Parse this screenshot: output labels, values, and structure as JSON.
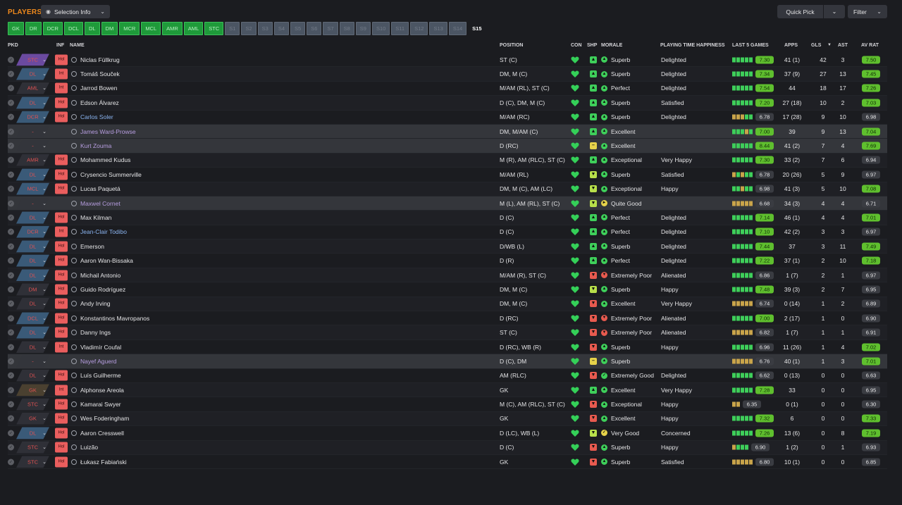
{
  "title": "PLAYERS",
  "selection_info": "Selection Info",
  "quick_pick": "Quick Pick",
  "filter": "Filter",
  "tabs": [
    "GK",
    "DR",
    "DCR",
    "DCL",
    "DL",
    "DM",
    "MCR",
    "MCL",
    "AMR",
    "AML",
    "STC",
    "S1",
    "S2",
    "S3",
    "S4",
    "S5",
    "S6",
    "S7",
    "S8",
    "S9",
    "S10",
    "S11",
    "S12",
    "S13",
    "S14",
    "S15"
  ],
  "headers": {
    "pkd": "PKD",
    "inf": "INF",
    "name": "NAME",
    "position": "POSITION",
    "con": "CON",
    "shp": "SHP",
    "morale": "MORALE",
    "pth": "PLAYING TIME HAPPINESS",
    "last5": "LAST 5 GAMES",
    "apps": "APPS",
    "gls": "GLS",
    "ast": "AST",
    "avrat": "AV RAT"
  },
  "colors": {
    "accent": "#f08a1c",
    "green_rating": "#5fbf2e",
    "grey_rating": "#3a3c42"
  },
  "players": [
    {
      "pkd": "STC",
      "pkdc": "#6b4aa0",
      "inf": "Hol",
      "name": "Niclas Füllkrug",
      "position": "ST (C)",
      "shp": "up",
      "morale": "Superb",
      "pth": "Delighted",
      "l5": "7.30",
      "l5g": true,
      "bars": "GGGGG",
      "apps": "41 (1)",
      "gls": "42",
      "ast": "3",
      "av": "7.50",
      "avg": true
    },
    {
      "pkd": "DL",
      "pkdc": "#3a5a78",
      "inf": "Int",
      "name": "Tomáš Souček",
      "position": "DM, M (C)",
      "shp": "up",
      "morale": "Superb",
      "pth": "Delighted",
      "l5": "7.34",
      "l5g": true,
      "bars": "GGGGG",
      "apps": "37 (9)",
      "gls": "27",
      "ast": "13",
      "av": "7.45",
      "avg": true
    },
    {
      "pkd": "AML",
      "pkdc": "#2f3037",
      "inf": "Int",
      "name": "Jarrod Bowen",
      "position": "M/AM (RL), ST (C)",
      "shp": "up",
      "morale": "Perfect",
      "pth": "Delighted",
      "l5": "7.54",
      "l5g": true,
      "bars": "GGGGG",
      "apps": "44",
      "gls": "18",
      "ast": "17",
      "av": "7.26",
      "avg": true
    },
    {
      "pkd": "DL",
      "pkdc": "#3a5a78",
      "inf": "Hol",
      "name": "Edson Álvarez",
      "position": "D (C), DM, M (C)",
      "shp": "up",
      "morale": "Superb",
      "pth": "Satisfied",
      "l5": "7.20",
      "l5g": true,
      "bars": "GGGGG",
      "apps": "27 (18)",
      "gls": "10",
      "ast": "2",
      "av": "7.03",
      "avg": true
    },
    {
      "pkd": "DCR",
      "pkdc": "#3a5a78",
      "inf": "Hol",
      "name": "Carlos Soler",
      "nc": "hl",
      "position": "M/AM (RC)",
      "shp": "up",
      "morale": "Superb",
      "pth": "Delighted",
      "l5": "6.78",
      "l5g": false,
      "bars": "YYYGG",
      "apps": "17 (28)",
      "gls": "9",
      "ast": "10",
      "av": "6.98",
      "avg": false
    },
    {
      "pkd": "-",
      "pkdc": "#33353b",
      "inf": "",
      "name": "James Ward-Prowse",
      "nc": "purple",
      "position": "DM, M/AM (C)",
      "shp": "up",
      "morale": "Excellent",
      "pth": "",
      "l5": "7.00",
      "l5g": true,
      "bars": "GGGYG",
      "apps": "39",
      "gls": "9",
      "ast": "13",
      "av": "7.04",
      "avg": true,
      "dark": true
    },
    {
      "pkd": "-",
      "pkdc": "#33353b",
      "inf": "",
      "name": "Kurt Zouma",
      "nc": "purple",
      "position": "D (RC)",
      "shp": "flat",
      "morale": "Excellent",
      "pth": "",
      "l5": "8.44",
      "l5g": true,
      "bars": "GGGGG",
      "apps": "41 (2)",
      "gls": "7",
      "ast": "4",
      "av": "7.69",
      "avg": true,
      "dark": true
    },
    {
      "pkd": "AMR",
      "pkdc": "#2f3037",
      "inf": "Hol",
      "name": "Mohammed Kudus",
      "position": "M (R), AM (RLC), ST (C)",
      "shp": "up",
      "morale": "Exceptional",
      "pth": "Very Happy",
      "l5": "7.30",
      "l5g": true,
      "bars": "GGGGG",
      "apps": "33 (2)",
      "gls": "7",
      "ast": "6",
      "av": "6.94",
      "avg": false
    },
    {
      "pkd": "DL",
      "pkdc": "#3a5a78",
      "inf": "Hol",
      "name": "Crysencio Summerville",
      "position": "M/AM (RL)",
      "shp": "down",
      "morale": "Superb",
      "pth": "Satisfied",
      "l5": "6.78",
      "l5g": false,
      "bars": "YGYGG",
      "apps": "20 (26)",
      "gls": "5",
      "ast": "9",
      "av": "6.97",
      "avg": false
    },
    {
      "pkd": "MCL",
      "pkdc": "#3a5a78",
      "inf": "Hol",
      "name": "Lucas Paquetá",
      "position": "DM, M (C), AM (LC)",
      "shp": "down",
      "morale": "Exceptional",
      "pth": "Happy",
      "l5": "6.98",
      "l5g": false,
      "bars": "GGYGG",
      "apps": "41 (3)",
      "gls": "5",
      "ast": "10",
      "av": "7.08",
      "avg": true
    },
    {
      "pkd": "-",
      "pkdc": "#33353b",
      "inf": "",
      "name": "Maxwel Cornet",
      "nc": "purple",
      "position": "M (L), AM (RL), ST (C)",
      "shp": "down",
      "morale": "Quite Good",
      "pth": "",
      "l5": "6.68",
      "l5g": false,
      "bars": "YYYYY",
      "apps": "34 (3)",
      "gls": "4",
      "ast": "4",
      "av": "6.71",
      "avg": false,
      "dark": true
    },
    {
      "pkd": "DL",
      "pkdc": "#3a5a78",
      "inf": "Hol",
      "name": "Max Kilman",
      "position": "D (C)",
      "shp": "up",
      "morale": "Perfect",
      "pth": "Delighted",
      "l5": "7.14",
      "l5g": true,
      "bars": "GGGGG",
      "apps": "46 (1)",
      "gls": "4",
      "ast": "4",
      "av": "7.01",
      "avg": true
    },
    {
      "pkd": "DCR",
      "pkdc": "#3a5a78",
      "inf": "Int",
      "name": "Jean-Clair Todibo",
      "nc": "hl",
      "position": "D (C)",
      "shp": "up",
      "morale": "Perfect",
      "pth": "Delighted",
      "l5": "7.10",
      "l5g": true,
      "bars": "GGGGG",
      "apps": "42 (2)",
      "gls": "3",
      "ast": "3",
      "av": "6.97",
      "avg": false
    },
    {
      "pkd": "DL",
      "pkdc": "#3a5a78",
      "inf": "Hol",
      "name": "Emerson",
      "position": "D/WB (L)",
      "shp": "up",
      "morale": "Superb",
      "pth": "Delighted",
      "l5": "7.44",
      "l5g": true,
      "bars": "GGGGG",
      "apps": "37",
      "gls": "3",
      "ast": "11",
      "av": "7.49",
      "avg": true
    },
    {
      "pkd": "DL",
      "pkdc": "#3a5a78",
      "inf": "Hol",
      "name": "Aaron Wan-Bissaka",
      "position": "D (R)",
      "shp": "up",
      "morale": "Perfect",
      "pth": "Delighted",
      "l5": "7.22",
      "l5g": true,
      "bars": "GGGGG",
      "apps": "37 (1)",
      "gls": "2",
      "ast": "10",
      "av": "7.18",
      "avg": true
    },
    {
      "pkd": "DL",
      "pkdc": "#3a5a78",
      "inf": "Hol",
      "name": "Michail Antonio",
      "position": "M/AM (R), ST (C)",
      "shp": "bad",
      "morale": "Extremely Poor",
      "pth": "Alienated",
      "l5": "6.86",
      "l5g": false,
      "bars": "GGGGG",
      "apps": "1 (7)",
      "gls": "2",
      "ast": "1",
      "av": "6.97",
      "avg": false
    },
    {
      "pkd": "DM",
      "pkdc": "#2f3037",
      "inf": "Hol",
      "name": "Guido Rodríguez",
      "position": "DM, M (C)",
      "shp": "down",
      "morale": "Superb",
      "pth": "Happy",
      "l5": "7.48",
      "l5g": true,
      "bars": "GGGGG",
      "apps": "39 (3)",
      "gls": "2",
      "ast": "7",
      "av": "6.95",
      "avg": false
    },
    {
      "pkd": "DL",
      "pkdc": "#2f3037",
      "inf": "Hol",
      "name": "Andy Irving",
      "position": "DM, M (C)",
      "shp": "bad",
      "morale": "Excellent",
      "pth": "Very Happy",
      "l5": "6.74",
      "l5g": false,
      "bars": "YYYYY",
      "apps": "0 (14)",
      "gls": "1",
      "ast": "2",
      "av": "6.89",
      "avg": false
    },
    {
      "pkd": "DCL",
      "pkdc": "#3a5a78",
      "inf": "Hol",
      "name": "Konstantinos Mavropanos",
      "position": "D (RC)",
      "shp": "bad",
      "morale": "Extremely Poor",
      "pth": "Alienated",
      "l5": "7.00",
      "l5g": true,
      "bars": "GGGGG",
      "apps": "2 (17)",
      "gls": "1",
      "ast": "0",
      "av": "6.90",
      "avg": false
    },
    {
      "pkd": "DL",
      "pkdc": "#3a5a78",
      "inf": "Hol",
      "name": "Danny Ings",
      "position": "ST (C)",
      "shp": "bad",
      "morale": "Extremely Poor",
      "pth": "Alienated",
      "l5": "6.82",
      "l5g": false,
      "bars": "YYYYY",
      "apps": "1 (7)",
      "gls": "1",
      "ast": "1",
      "av": "6.91",
      "avg": false
    },
    {
      "pkd": "DL",
      "pkdc": "#2f3037",
      "inf": "Int",
      "name": "Vladimír Coufal",
      "position": "D (RC), WB (R)",
      "shp": "bad",
      "morale": "Superb",
      "pth": "Happy",
      "l5": "6.96",
      "l5g": false,
      "bars": "GGGGG",
      "apps": "11 (26)",
      "gls": "1",
      "ast": "4",
      "av": "7.02",
      "avg": true
    },
    {
      "pkd": "-",
      "pkdc": "#33353b",
      "inf": "",
      "name": "Nayef Aguerd",
      "nc": "purple",
      "position": "D (C), DM",
      "shp": "flat",
      "morale": "Superb",
      "pth": "",
      "l5": "6.76",
      "l5g": false,
      "bars": "YYYYY",
      "apps": "40 (1)",
      "gls": "1",
      "ast": "3",
      "av": "7.01",
      "avg": true,
      "dark": true
    },
    {
      "pkd": "DL",
      "pkdc": "#2f3037",
      "inf": "Hol",
      "name": "Luís Guilherme",
      "position": "AM (RLC)",
      "shp": "bad",
      "morale": "Extremely Good",
      "pth": "Delighted",
      "l5": "6.62",
      "l5g": false,
      "bars": "GGGGG",
      "apps": "0 (13)",
      "gls": "0",
      "ast": "0",
      "av": "6.63",
      "avg": false
    },
    {
      "pkd": "GK",
      "pkdc": "#4a4030",
      "inf": "Int",
      "name": "Alphonse Areola",
      "position": "GK",
      "shp": "up",
      "morale": "Excellent",
      "pth": "Very Happy",
      "l5": "7.28",
      "l5g": true,
      "bars": "GGGGG",
      "apps": "33",
      "gls": "0",
      "ast": "0",
      "av": "6.95",
      "avg": false
    },
    {
      "pkd": "STC",
      "pkdc": "#2f3037",
      "inf": "Hol",
      "name": "Kamarai Swyer",
      "position": "M (C), AM (RLC), ST (C)",
      "shp": "bad",
      "morale": "Exceptional",
      "pth": "Happy",
      "l5": "6.35",
      "l5g": false,
      "bars": "YY",
      "apps": "0 (1)",
      "gls": "0",
      "ast": "0",
      "av": "6.30",
      "avg": false
    },
    {
      "pkd": "GK",
      "pkdc": "#2f3037",
      "inf": "Hol",
      "name": "Wes Foderingham",
      "position": "GK",
      "shp": "bad",
      "morale": "Excellent",
      "pth": "Happy",
      "l5": "7.32",
      "l5g": true,
      "bars": "GGGGG",
      "apps": "6",
      "gls": "0",
      "ast": "0",
      "av": "7.33",
      "avg": true
    },
    {
      "pkd": "DL",
      "pkdc": "#3a5a78",
      "inf": "Hol",
      "name": "Aaron Cresswell",
      "position": "D (LC), WB (L)",
      "shp": "down",
      "morale": "Very Good",
      "pth": "Concerned",
      "l5": "7.26",
      "l5g": true,
      "bars": "GGGGG",
      "apps": "13 (6)",
      "gls": "0",
      "ast": "8",
      "av": "7.19",
      "avg": true
    },
    {
      "pkd": "STC",
      "pkdc": "#2f3037",
      "inf": "Hol",
      "name": "Luizão",
      "position": "D (C)",
      "shp": "bad",
      "morale": "Superb",
      "pth": "Happy",
      "l5": "6.90",
      "l5g": false,
      "bars": "YGGG",
      "apps": "1 (2)",
      "gls": "0",
      "ast": "1",
      "av": "6.93",
      "avg": false
    },
    {
      "pkd": "STC",
      "pkdc": "#2f3037",
      "inf": "Hol",
      "name": "Łukasz Fabiański",
      "position": "GK",
      "shp": "bad",
      "morale": "Superb",
      "pth": "Satisfied",
      "l5": "6.80",
      "l5g": false,
      "bars": "YYYYY",
      "apps": "10 (1)",
      "gls": "0",
      "ast": "0",
      "av": "6.85",
      "avg": false
    }
  ]
}
